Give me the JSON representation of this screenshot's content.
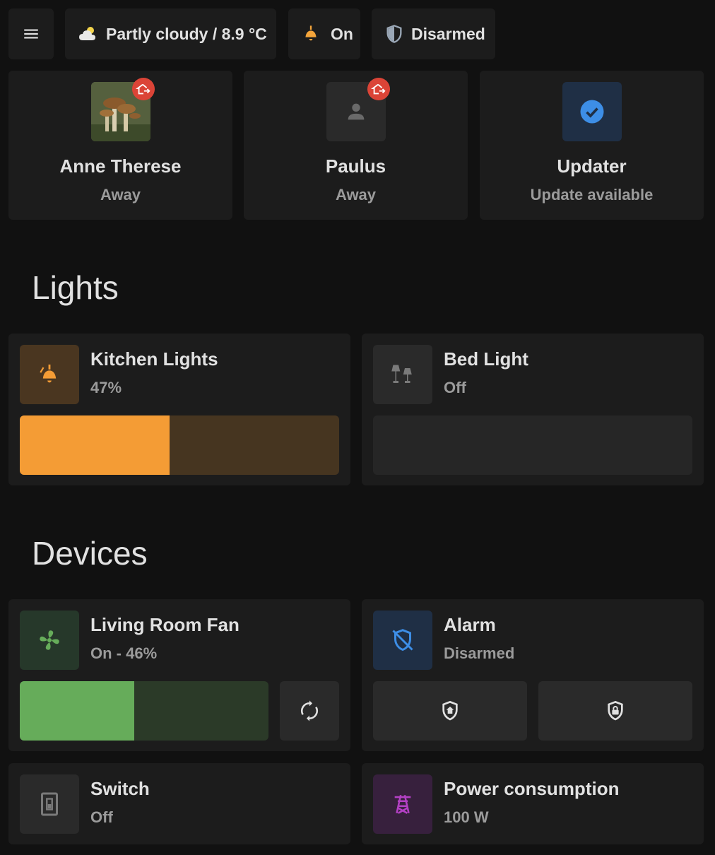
{
  "header": {
    "menu_icon": "menu-icon",
    "weather": {
      "icon": "partly-cloudy-icon",
      "label": "Partly cloudy / 8.9 °C"
    },
    "light_status": {
      "icon": "ceiling-light-icon",
      "label": "On",
      "color": "#f4a53b"
    },
    "alarm_status": {
      "icon": "shield-icon",
      "label": "Disarmed"
    }
  },
  "persons": [
    {
      "name": "Anne Therese",
      "state": "Away",
      "avatar": "mushroom-photo",
      "badge_icon": "home-export-icon"
    },
    {
      "name": "Paulus",
      "state": "Away",
      "avatar": "account-icon",
      "badge_icon": "home-export-icon"
    },
    {
      "name": "Updater",
      "state": "Update available",
      "avatar": "check-circle-icon"
    }
  ],
  "sections": {
    "lights": "Lights",
    "devices": "Devices"
  },
  "lights": [
    {
      "name": "Kitchen Lights",
      "state": "47%",
      "icon": "ceiling-light-icon",
      "brightness": 0.47,
      "color": "#f49c35"
    },
    {
      "name": "Bed Light",
      "state": "Off",
      "icon": "lamps-icon",
      "brightness": 0
    }
  ],
  "devices": {
    "fan": {
      "name": "Living Room Fan",
      "state": "On - 46%",
      "icon": "fan-icon",
      "speed": 0.46,
      "color": "#66ac5a",
      "oscillate_icon": "sync-icon"
    },
    "alarm": {
      "name": "Alarm",
      "state": "Disarmed",
      "icon": "shield-off-icon",
      "arm_home_icon": "shield-home-icon",
      "arm_away_icon": "shield-lock-icon",
      "color": "#3d8ee6"
    },
    "switch": {
      "name": "Switch",
      "state": "Off",
      "icon": "light-switch-icon"
    },
    "power": {
      "name": "Power consumption",
      "state": "100 W",
      "icon": "transmission-tower-icon",
      "color": "#b340c4"
    }
  }
}
